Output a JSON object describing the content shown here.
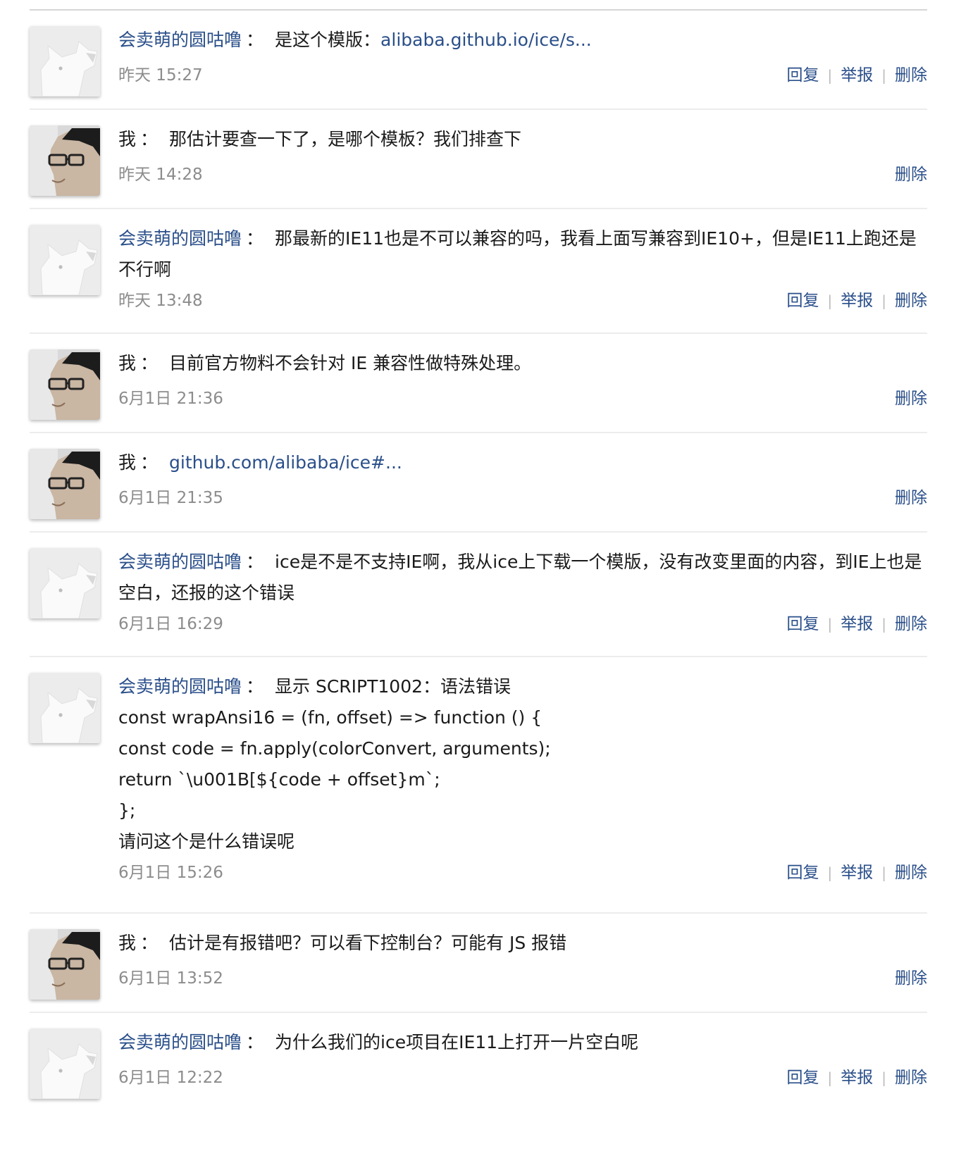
{
  "labels": {
    "reply": "回复",
    "report": "举报",
    "delete": "删除",
    "separator": "|",
    "colon": "："
  },
  "comments": [
    {
      "author": "会卖萌的圆咕噜",
      "self": false,
      "text": "是这个模版：",
      "link": "alibaba.github.io/ice/s...",
      "time": "昨天 15:27"
    },
    {
      "author": "我",
      "self": true,
      "text": "那估计要查一下了，是哪个模板？我们排查下",
      "time": "昨天 14:28"
    },
    {
      "author": "会卖萌的圆咕噜",
      "self": false,
      "text": "那最新的IE11也是不可以兼容的吗，我看上面写兼容到IE10+，但是IE11上跑还是不行啊",
      "time": "昨天 13:48"
    },
    {
      "author": "我",
      "self": true,
      "text": "目前官方物料不会针对 IE 兼容性做特殊处理。",
      "time": "6月1日 21:36"
    },
    {
      "author": "我",
      "self": true,
      "text": "",
      "link": "github.com/alibaba/ice#...",
      "time": "6月1日 21:35"
    },
    {
      "author": "会卖萌的圆咕噜",
      "self": false,
      "text": "ice是不是不支持IE啊，我从ice上下载一个模版，没有改变里面的内容，到IE上也是空白，还报的这个错误",
      "time": "6月1日 16:29"
    },
    {
      "author": "会卖萌的圆咕噜",
      "self": false,
      "text": "显示 SCRIPT1002：语法错误",
      "extra_lines": [
        "const wrapAnsi16 = (fn, offset) => function () {",
        "const code = fn.apply(colorConvert, arguments);",
        "return `\\u001B[${code + offset}m`;",
        "};",
        "请问这个是什么错误呢"
      ],
      "time": "6月1日 15:26"
    },
    {
      "author": "我",
      "self": true,
      "text": "估计是有报错吧？可以看下控制台？可能有 JS 报错",
      "time": "6月1日 13:52"
    },
    {
      "author": "会卖萌的圆咕噜",
      "self": false,
      "text": "为什么我们的ice项目在IE11上打开一片空白呢",
      "time": "6月1日 12:22"
    }
  ]
}
